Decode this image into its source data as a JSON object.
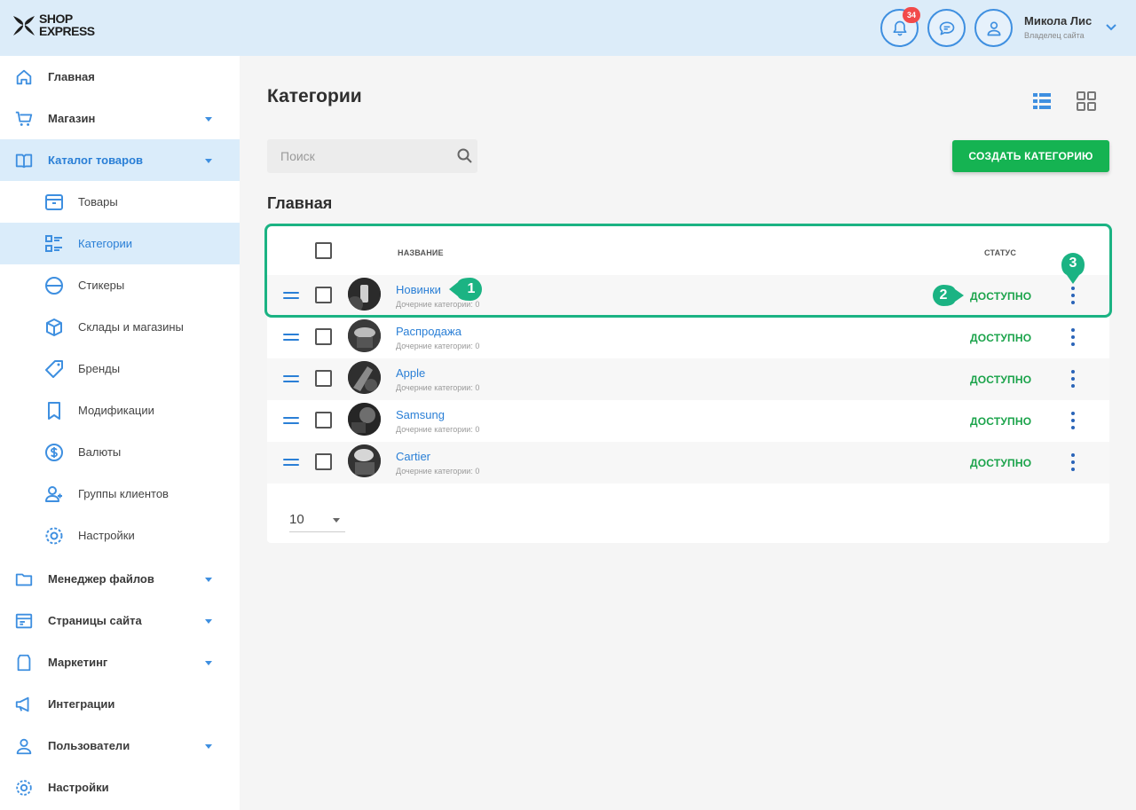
{
  "header": {
    "logo_line1": "SHOP",
    "logo_line2": "EXPRESS",
    "notification_count": "34",
    "user_name": "Микола Лис",
    "user_role": "Владелец сайта"
  },
  "sidebar": {
    "items": [
      {
        "label": "Главная",
        "icon": "home-icon",
        "has_caret": false
      },
      {
        "label": "Магазин",
        "icon": "cart-icon",
        "has_caret": true
      },
      {
        "label": "Каталог товаров",
        "icon": "catalog-icon",
        "has_caret": true,
        "active": true
      },
      {
        "label": "Менеджер файлов",
        "icon": "folder-icon",
        "has_caret": true
      },
      {
        "label": "Страницы сайта",
        "icon": "pages-icon",
        "has_caret": true
      },
      {
        "label": "Маркетинг",
        "icon": "marketing-icon",
        "has_caret": true
      },
      {
        "label": "Интеграции",
        "icon": "megaphone-icon",
        "has_caret": false
      },
      {
        "label": "Пользователи",
        "icon": "users-icon",
        "has_caret": true
      },
      {
        "label": "Настройки",
        "icon": "gear-icon",
        "has_caret": false
      }
    ],
    "subitems": [
      {
        "label": "Товары",
        "icon": "box-icon"
      },
      {
        "label": "Категории",
        "icon": "categories-icon",
        "active": true
      },
      {
        "label": "Стикеры",
        "icon": "sticker-icon"
      },
      {
        "label": "Склады и магазины",
        "icon": "warehouse-icon"
      },
      {
        "label": "Бренды",
        "icon": "tag-icon"
      },
      {
        "label": "Модификации",
        "icon": "bookmark-icon"
      },
      {
        "label": "Валюты",
        "icon": "dollar-icon"
      },
      {
        "label": "Группы клиентов",
        "icon": "client-group-icon"
      },
      {
        "label": "Настройки",
        "icon": "gear-icon"
      }
    ]
  },
  "main": {
    "title": "Категории",
    "search_placeholder": "Поиск",
    "create_button": "СОЗДАТЬ КАТЕГОРИЮ",
    "section_title": "Главная",
    "table": {
      "col_name": "НАЗВАНИЕ",
      "col_status": "СТАТУС",
      "rows": [
        {
          "name": "Новинки",
          "children": "Дочерние категории: 0",
          "status": "ДОСТУПНО"
        },
        {
          "name": "Распродажа",
          "children": "Дочерние категории: 0",
          "status": "ДОСТУПНО"
        },
        {
          "name": "Apple",
          "children": "Дочерние категории: 0",
          "status": "ДОСТУПНО"
        },
        {
          "name": "Samsung",
          "children": "Дочерние категории: 0",
          "status": "ДОСТУПНО"
        },
        {
          "name": "Cartier",
          "children": "Дочерние категории: 0",
          "status": "ДОСТУПНО"
        }
      ]
    },
    "page_size": "10"
  },
  "annotations": {
    "marker1": "1",
    "marker2": "2",
    "marker3": "3"
  },
  "colors": {
    "accent_blue": "#2a7fd6",
    "success_green": "#15b352",
    "annotation_teal": "#1bb383",
    "header_bg": "#dcecf9",
    "badge_red": "#f24a4a"
  }
}
